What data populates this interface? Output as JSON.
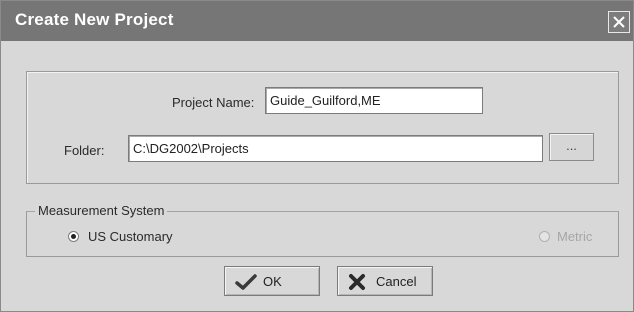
{
  "dialog": {
    "title": "Create New Project",
    "close_icon": "close-x-icon"
  },
  "project": {
    "name_label": "Project Name:",
    "name_value": "Guide_Guilford,ME",
    "folder_label": "Folder:",
    "folder_value": "C:\\DG2002\\Projects",
    "browse_label": "..."
  },
  "measurement": {
    "legend": "Measurement System",
    "options": [
      {
        "label": "US Customary",
        "selected": true,
        "enabled": true
      },
      {
        "label": "Metric",
        "selected": false,
        "enabled": false
      }
    ]
  },
  "buttons": {
    "ok_label": "OK",
    "ok_icon": "checkmark-icon",
    "cancel_label": "Cancel",
    "cancel_icon": "x-mark-icon"
  }
}
